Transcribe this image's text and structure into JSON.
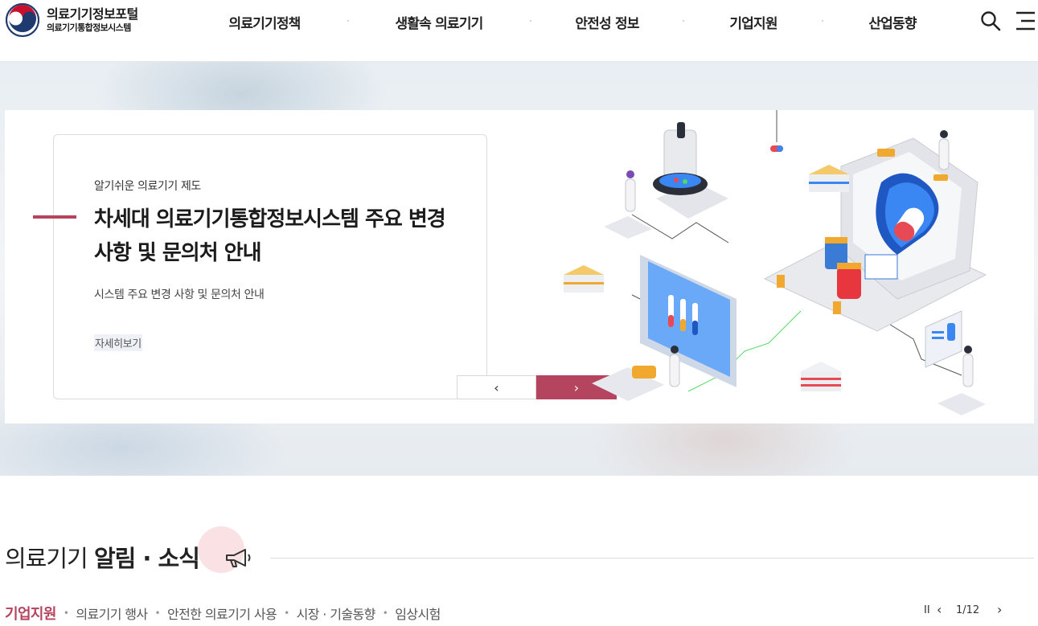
{
  "header": {
    "logo": {
      "title": "의료기기정보포털",
      "subtitle": "의료기기통합정보시스템"
    },
    "nav": [
      "의료기기정책",
      "생활속 의료기기",
      "안전성 정보",
      "기업지원",
      "산업동향"
    ],
    "icons": [
      "search-icon",
      "menu-icon"
    ]
  },
  "hero": {
    "kicker": "알기쉬운 의료기기 제도",
    "title": "차세대 의료기기통합정보시스템 주요 변경 사항 및 문의처 안내",
    "description": "시스템 주요 변경 사항 및 문의처 안내",
    "more_label": "자세히보기",
    "prev_label": "‹",
    "next_label": "›",
    "accent_color": "#b5455e"
  },
  "news": {
    "title_light": "의료기기 ",
    "title_strong": "알림 · 소식",
    "tabs": [
      "기업지원",
      "의료기기 행사",
      "안전한 의료기기 사용",
      "시장 · 기술동향",
      "임상시험"
    ],
    "active_tab": "기업지원",
    "pager": {
      "pause_label": "II",
      "prev_label": "‹",
      "page": "1/12",
      "next_label": "›"
    }
  }
}
